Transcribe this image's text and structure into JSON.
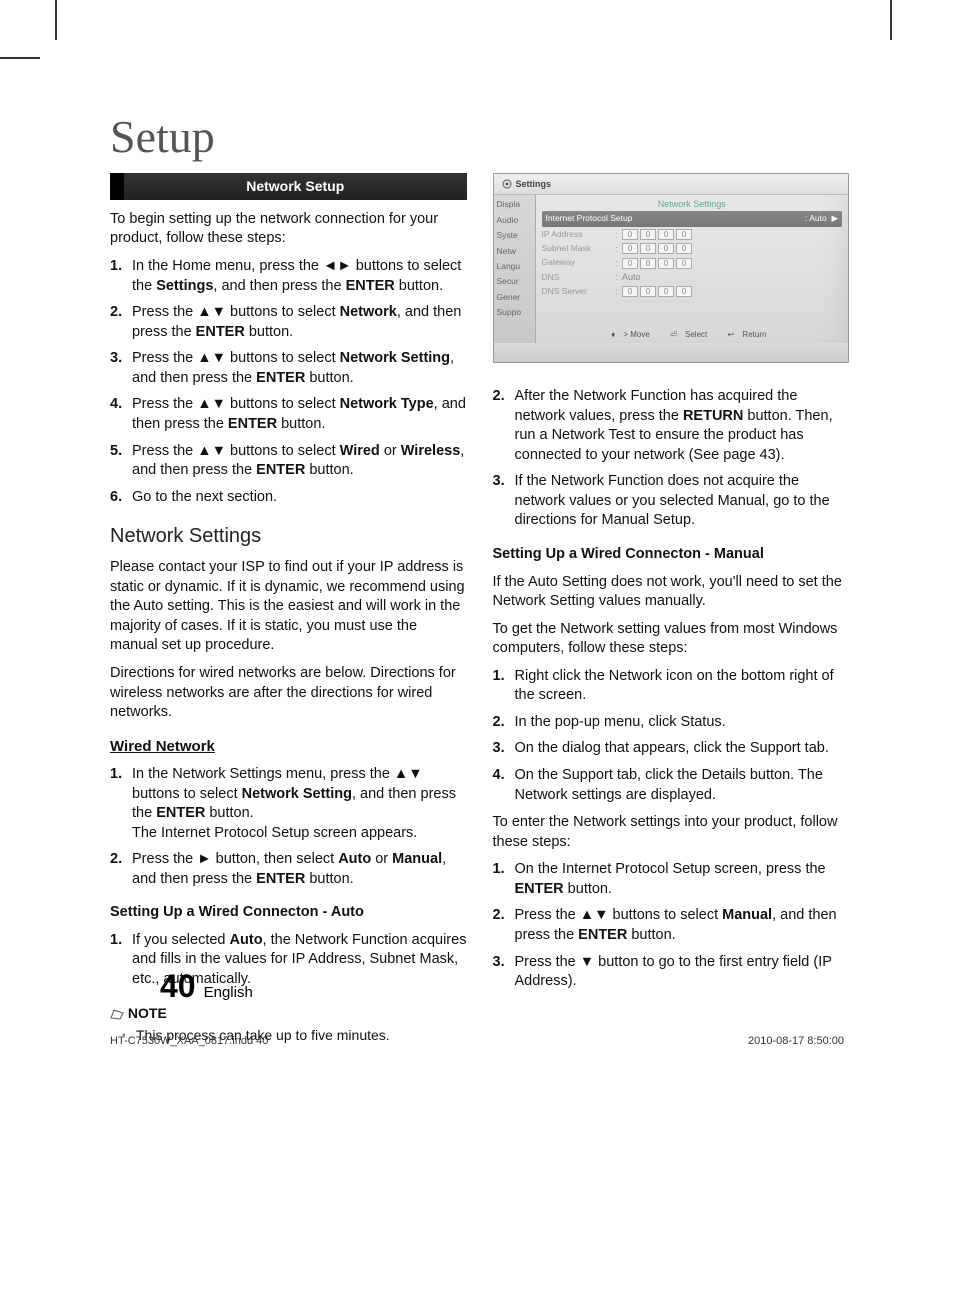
{
  "title": "Setup",
  "sectionBar": "Network Setup",
  "intro": "To begin setting up the network connection for your product, follow these steps:",
  "steps1": [
    {
      "n": "1.",
      "html": "In the Home menu, press the ◄► buttons to select the <b>Settings</b>, and then press the <b>ENTER</b> button."
    },
    {
      "n": "2.",
      "html": "Press the ▲▼ buttons to select <b>Network</b>, and then press the <b>ENTER</b> button."
    },
    {
      "n": "3.",
      "html": "Press the ▲▼ buttons to select <b>Network Setting</b>, and then press the <b>ENTER</b> button."
    },
    {
      "n": "4.",
      "html": "Press the ▲▼ buttons to select <b>Network Type</b>, and then press the <b>ENTER</b> button."
    },
    {
      "n": "5.",
      "html": "Press the ▲▼ buttons to select <b>Wired</b> or <b>Wireless</b>, and then press the <b>ENTER</b> button."
    },
    {
      "n": "6.",
      "html": "Go to the next section."
    }
  ],
  "h2": "Network Settings",
  "para1": "Please contact your ISP to find out if your IP address is static or dynamic. If it is dynamic, we recommend using the Auto setting. This is the easiest and will work in the majority of cases. If it is static, you must use the manual set up procedure.",
  "para2": "Directions for wired networks are below. Directions for wireless networks are after the directions for wired networks.",
  "h3": "Wired Network",
  "steps2": [
    {
      "n": "1.",
      "html": "In the Network Settings menu, press the ▲▼ buttons to select <b>Network Setting</b>, and then press the <b>ENTER</b> button.<br>The Internet Protocol Setup screen appears."
    },
    {
      "n": "2.",
      "html": "Press the ► button, then select <b>Auto</b> or <b>Manual</b>, and then press the <b>ENTER</b> button."
    }
  ],
  "h4a": "Setting Up a Wired Connecton - Auto",
  "steps3": [
    {
      "n": "1.",
      "html": "If you selected <b>Auto</b>, the Network Function acquires and fills in the values for IP Address, Subnet Mask, etc., automatically."
    }
  ],
  "noteLabel": "NOTE",
  "noteItem": "This process can take up to five minutes.",
  "tv": {
    "header": "Settings",
    "sideItems": [
      "Displa",
      "Audio",
      "Syste",
      "Netw",
      "Langu",
      "Secur",
      "Gener",
      "Suppo"
    ],
    "panelTitle": "Network Settings",
    "row1Label": "Internet Protocol Setup",
    "row1Value": ": Auto",
    "fields": [
      {
        "label": "IP Address",
        "type": "ip"
      },
      {
        "label": "Subnet Mask",
        "type": "ip"
      },
      {
        "label": "Gateway",
        "type": "ip"
      },
      {
        "label": "DNS",
        "type": "text",
        "val": ": Auto"
      },
      {
        "label": "DNS Server",
        "type": "ip"
      }
    ],
    "footMove": "> Move",
    "footSelect": "Select",
    "footReturn": "Return"
  },
  "steps4": [
    {
      "n": "2.",
      "html": "After the Network Function has acquired the network values, press the <b>RETURN</b> button. Then, run a Network Test to ensure the product has connected to your network (See page 43)."
    },
    {
      "n": "3.",
      "html": "If the Network Function does not acquire the network values or you selected Manual, go to the directions for Manual Setup."
    }
  ],
  "h4b": "Setting Up a Wired Connecton - Manual",
  "para3": "If the Auto Setting does not work, you'll need to set the Network Setting values manually.",
  "para4": "To get the Network setting values from most Windows computers, follow these steps:",
  "steps5": [
    {
      "n": "1.",
      "html": "Right click the Network icon on the bottom right of the screen."
    },
    {
      "n": "2.",
      "html": "In the pop-up menu, click Status."
    },
    {
      "n": "3.",
      "html": "On the dialog that appears, click the Support tab."
    },
    {
      "n": "4.",
      "html": "On the Support tab, click the Details button. The Network settings are displayed."
    }
  ],
  "para5": "To enter the Network settings into your product, follow these steps:",
  "steps6": [
    {
      "n": "1.",
      "html": "On the Internet Protocol Setup screen, press the <b>ENTER</b> button."
    },
    {
      "n": "2.",
      "html": "Press the ▲▼ buttons to select <b>Manual</b>, and then press the <b>ENTER</b> button."
    },
    {
      "n": "3.",
      "html": "Press the ▼ button to go to the first entry field (IP Address)."
    }
  ],
  "pageNum": "40",
  "pageLang": "English",
  "printFile": "HT-C7530W_XAA_0817.indd   40",
  "printDate": "2010-08-17   8:50:00"
}
